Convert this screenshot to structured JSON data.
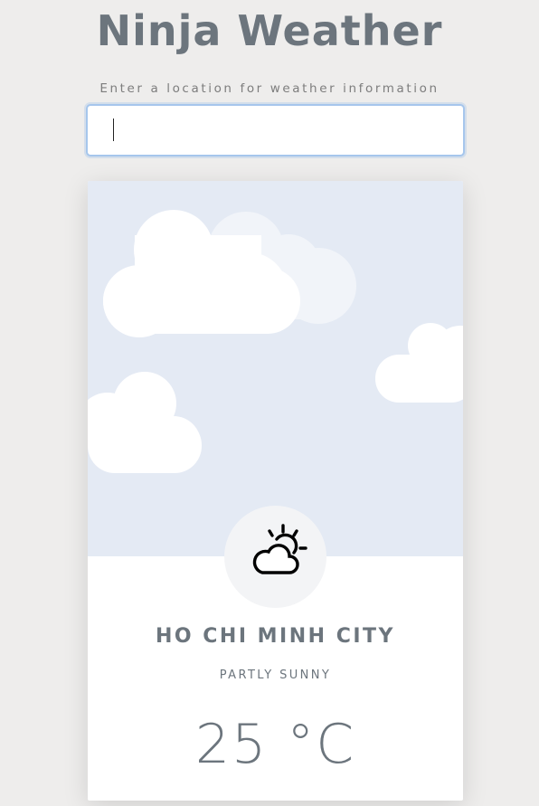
{
  "app": {
    "title": "Ninja Weather",
    "prompt": "Enter a location for weather information"
  },
  "search": {
    "value": "",
    "placeholder": ""
  },
  "weather": {
    "city": "HO CHI MINH CITY",
    "condition": "PARTLY SUNNY",
    "temperature": "25 °C",
    "icon": "partly-sunny-icon"
  },
  "colors": {
    "sky": "#e4eaf4",
    "card": "#ffffff",
    "text": "#6c757d",
    "input_border": "#a6c6ec"
  }
}
